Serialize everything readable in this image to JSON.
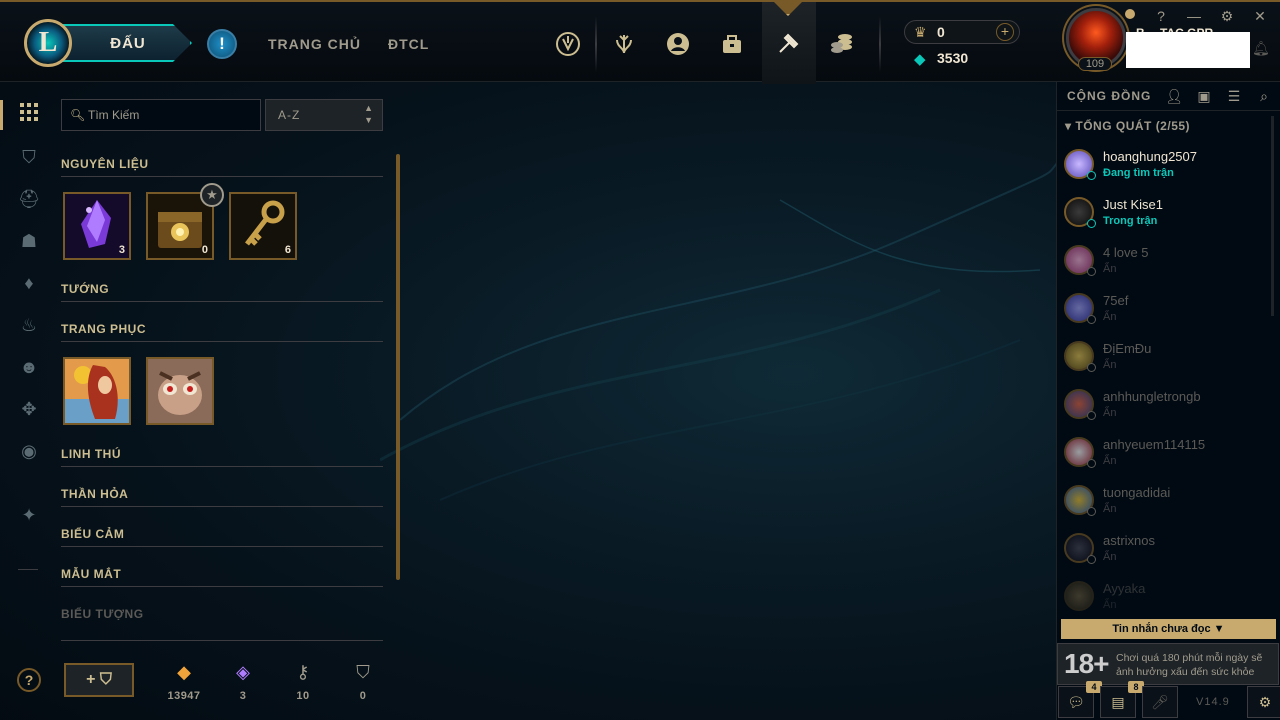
{
  "top": {
    "play_label": "ĐẤU",
    "nav_home": "TRANG CHỦ",
    "nav_tft": "ĐTCL",
    "rp_value": "0",
    "be_value": "3530"
  },
  "profile": {
    "level": "109",
    "name_partial": "B… TAC GPR"
  },
  "inventory": {
    "search_placeholder": "Tìm Kiếm",
    "sort_value": "A-Z",
    "sections": {
      "materials": "NGUYÊN LIỆU",
      "champions": "TƯỚNG",
      "skins": "TRANG PHỤC",
      "companions": "LINH THÚ",
      "ward_skins": "THẦN HỎA",
      "emotes": "BIỂU CẢM",
      "eye_skins": "MẪU MẮT",
      "icons": "BIỂU TƯỢNG"
    },
    "materials": [
      {
        "name": "mythic-essence",
        "count": "3"
      },
      {
        "name": "hextech-chest",
        "count": "0"
      },
      {
        "name": "key",
        "count": "6"
      }
    ],
    "wallet": [
      {
        "name": "orange-essence",
        "value": "13947"
      },
      {
        "name": "mythic-essence",
        "value": "3"
      },
      {
        "name": "key-fragment",
        "value": "10"
      },
      {
        "name": "chest",
        "value": "0"
      }
    ]
  },
  "social": {
    "title": "CỘNG ĐỒNG",
    "group": "TỔNG QUÁT (2/55)",
    "friends": [
      {
        "name": "hoanghung2507",
        "status": "Đang tìm trận"
      },
      {
        "name": "Just Kise1",
        "status": "Trong trận"
      },
      {
        "name": "4 love 5",
        "status": "Ẩn"
      },
      {
        "name": "75ef",
        "status": "Ẩn"
      },
      {
        "name": "ĐịEmĐu",
        "status": "Ẩn"
      },
      {
        "name": "anhhungletrongb",
        "status": "Ẩn"
      },
      {
        "name": "anhyeuem114115",
        "status": "Ẩn"
      },
      {
        "name": "tuongadidai",
        "status": "Ẩn"
      },
      {
        "name": "astrixnos",
        "status": "Ẩn"
      },
      {
        "name": "Ayyaka",
        "status": "Ẩn"
      }
    ],
    "unread": "Tin nhắn chưa đọc ▼",
    "age_rating": "18+",
    "warning": "Chơi quá 180 phút mỗi ngày sẽ ảnh hưởng xấu đến sức khỏe",
    "chat_badge": "4",
    "missions_badge": "8",
    "version": "V14.9"
  },
  "colors": {
    "gold": "#c8aa6e",
    "teal": "#0ac8b9",
    "background": "#010a13"
  }
}
